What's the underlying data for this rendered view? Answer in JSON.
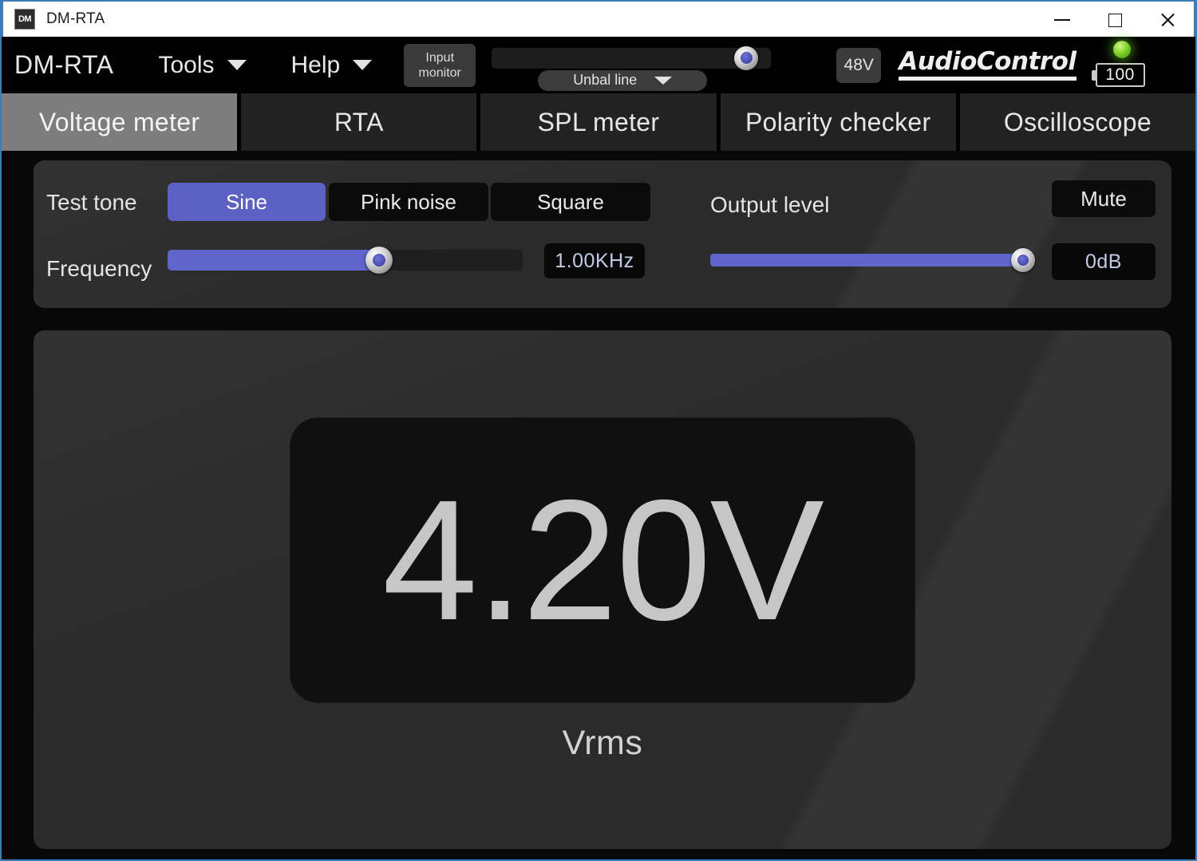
{
  "window": {
    "title": "DM-RTA",
    "icon_label": "DM",
    "controls": {
      "minimize": "minimize-icon",
      "maximize": "maximize-icon",
      "close": "close-icon"
    }
  },
  "toolbar": {
    "brand": "DM-RTA",
    "menus": [
      {
        "label": "Tools",
        "icon": "chevron-down-icon"
      },
      {
        "label": "Help",
        "icon": "chevron-down-icon"
      }
    ],
    "input_monitor": {
      "line1": "Input",
      "line2": "monitor"
    },
    "input_level": {
      "value": 87,
      "knob_icon": "slider-knob-icon"
    },
    "input_source": {
      "selected": "Unbal line",
      "icon": "chevron-down-icon"
    },
    "phantom_power": "48V",
    "logo": "AudioControl",
    "status_led": "green-led-icon",
    "battery": {
      "level": "100",
      "icon": "battery-icon"
    }
  },
  "tabs": [
    {
      "label": "Voltage meter",
      "active": true
    },
    {
      "label": "RTA",
      "active": false
    },
    {
      "label": "SPL meter",
      "active": false
    },
    {
      "label": "Polarity checker",
      "active": false
    },
    {
      "label": "Oscilloscope",
      "active": false
    }
  ],
  "controls": {
    "test_tone": {
      "label": "Test tone",
      "options": [
        {
          "label": "Sine",
          "selected": true
        },
        {
          "label": "Pink noise",
          "selected": false
        },
        {
          "label": "Square",
          "selected": false
        }
      ]
    },
    "frequency": {
      "label": "Frequency",
      "value": "1.00KHz",
      "slider_percent": 59
    },
    "output_level": {
      "label": "Output level",
      "value": "0dB",
      "slider_percent": 100,
      "mute_label": "Mute"
    }
  },
  "meter": {
    "value": "4.20V",
    "unit": "Vrms"
  },
  "colors": {
    "accent": "#6065cb",
    "accent_selected": "#5c61c4",
    "panel_bg": "#2b2b2b",
    "readout_bg": "#101010",
    "readout_text": "#c6c6c6",
    "value_text": "#c3cbe8",
    "tab_active_bg": "#7d7d7d",
    "tab_bg": "#222222",
    "led_green": "#7fd32a",
    "window_border": "#3a7cb8"
  }
}
